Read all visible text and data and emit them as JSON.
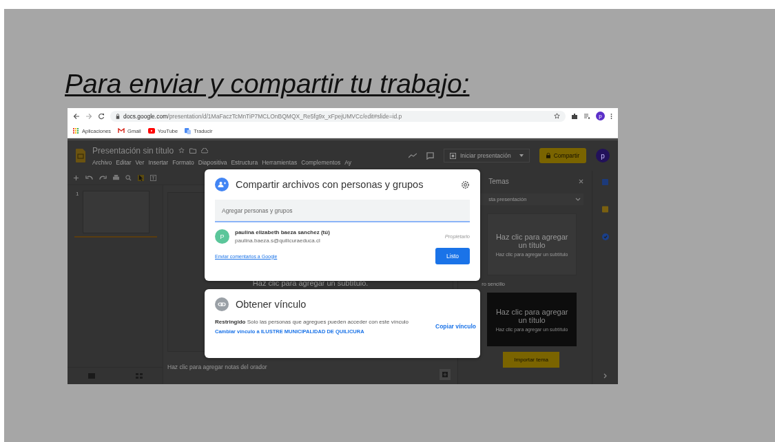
{
  "slide": {
    "title": "Para enviar y compartir tu trabajo:"
  },
  "browser": {
    "url_host": "docs.google.com",
    "url_path": "/presentation/d/1MaFaczTcMnTiP7MCLOnBQMQX_Re5fg9x_xFpejUMVCc/edit#slide=id.p",
    "profile_initial": "p",
    "bookmarks": [
      {
        "label": "Aplicaciones",
        "kind": "apps"
      },
      {
        "label": "Gmail",
        "kind": "gmail"
      },
      {
        "label": "YouTube",
        "kind": "youtube"
      },
      {
        "label": "Traducir",
        "kind": "translate"
      }
    ]
  },
  "app": {
    "doc_title": "Presentación sin título",
    "menu": [
      "Archivo",
      "Editar",
      "Ver",
      "Insertar",
      "Formato",
      "Diapositiva",
      "Estructura",
      "Herramientas",
      "Complementos",
      "Ay"
    ],
    "present_button": "Iniciar presentación",
    "share_button": "Compartir",
    "avatar_initial": "p",
    "slide_number": "1",
    "subtitle_placeholder": "Haz clic para agregar un subtítulo.",
    "notes_placeholder": "Haz clic para agregar notas del orador"
  },
  "themes": {
    "title": "Temas",
    "dropdown": "sta presentación",
    "section_label": "ro sencillo",
    "import_button": "Importar tema",
    "cards": [
      {
        "kind": "light",
        "title": "Haz clic para agregar un título",
        "subtitle": "Haz clic para agregar un subtítulo"
      },
      {
        "kind": "dark",
        "title": "Haz clic para agregar un título",
        "subtitle": "Haz clic para agregar un subtítulo"
      }
    ]
  },
  "share_dialog": {
    "title": "Compartir archivos con personas y grupos",
    "input": {
      "placeholder": "Agregar personas y grupos"
    },
    "people": [
      {
        "initial": "P",
        "name": "paulina elizabeth baeza sanchez (tú)",
        "email": "paulina.baeza.s@quilicuraeduca.cl",
        "role": "Propietario"
      }
    ],
    "feedback_link": "Enviar comentarios a Google",
    "done_button": "Listo"
  },
  "link_dialog": {
    "title": "Obtener vínculo",
    "description": "**Restringido** Solo las personas que agregues pueden acceder con este vínculo",
    "change_link": "Cambiar vínculo a ILUSTRE MUNICIPALIDAD DE QUILICURA",
    "copy_button": "Copiar vínculo"
  }
}
